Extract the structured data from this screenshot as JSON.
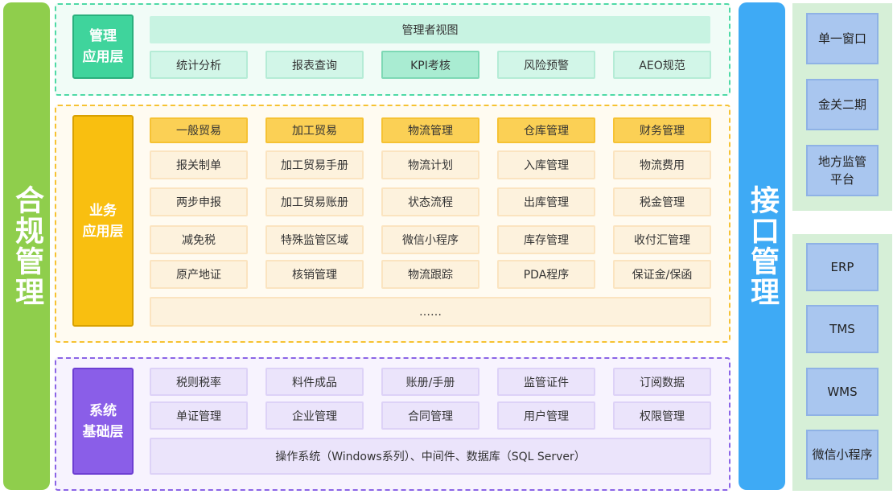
{
  "left_bar": {
    "label": "合规管理"
  },
  "right_bar": {
    "label": "接口管理"
  },
  "management_layer": {
    "label_line1": "管理",
    "label_line2": "应用层",
    "header": "管理者视图",
    "items": [
      "统计分析",
      "报表查询",
      "KPI考核",
      "风险预警",
      "AEO规范"
    ]
  },
  "business_layer": {
    "label_line1": "业务",
    "label_line2": "应用层",
    "columns": [
      {
        "header": "一般贸易",
        "items": [
          "报关制单",
          "两步申报",
          "减免税",
          "原产地证"
        ]
      },
      {
        "header": "加工贸易",
        "items": [
          "加工贸易手册",
          "加工贸易账册",
          "特殊监管区域",
          "核销管理"
        ]
      },
      {
        "header": "物流管理",
        "items": [
          "物流计划",
          "状态流程",
          "微信小程序",
          "物流跟踪"
        ]
      },
      {
        "header": "仓库管理",
        "items": [
          "入库管理",
          "出库管理",
          "库存管理",
          "PDA程序"
        ]
      },
      {
        "header": "财务管理",
        "items": [
          "物流费用",
          "税金管理",
          "收付汇管理",
          "保证金/保函"
        ]
      }
    ],
    "more": "……"
  },
  "system_layer": {
    "label_line1": "系统",
    "label_line2": "基础层",
    "row1": [
      "税则税率",
      "料件成品",
      "账册/手册",
      "监管证件",
      "订阅数据"
    ],
    "row2": [
      "单证管理",
      "企业管理",
      "合同管理",
      "用户管理",
      "权限管理"
    ],
    "footer": "操作系统（Windows系列）、中间件、数据库（SQL Server）"
  },
  "interfaces_top": [
    "单一窗口",
    "金关二期",
    "地方监管平台"
  ],
  "interfaces_bottom": [
    "ERP",
    "TMS",
    "WMS",
    "微信小程序"
  ],
  "colors": {
    "compliance_bar": "#8fce4c",
    "interface_bar": "#3eaaf5",
    "management": "#3fd49c",
    "business": "#f9bf10",
    "system": "#8a5ee8",
    "interface_box": "#a9c6ef",
    "interface_group": "#d6efd7"
  }
}
